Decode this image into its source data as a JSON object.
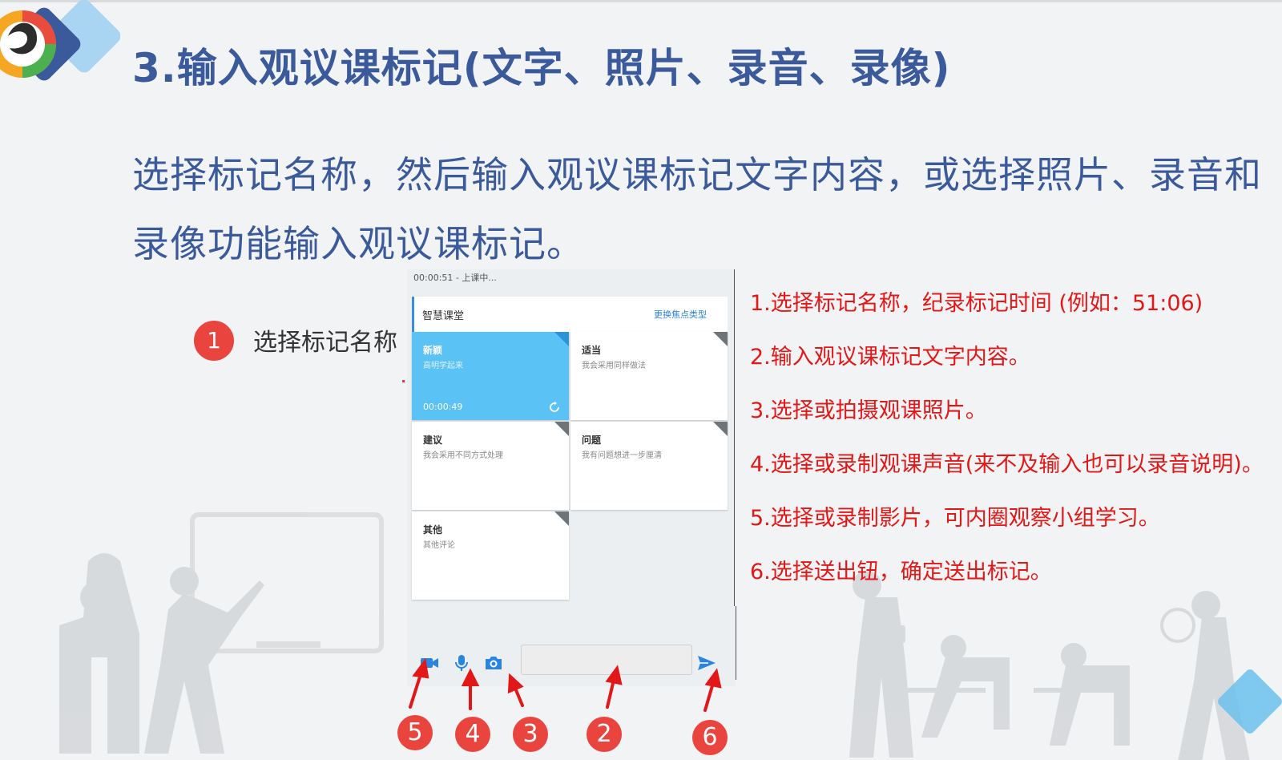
{
  "page": {
    "title": "3.输入观议课标记(文字、照片、录音、录像)",
    "intro": "选择标记名称，然后输入观议课标记文字内容，或选择照片、录音和录像功能输入观议课标记。",
    "step": {
      "number": "1",
      "label": "选择标记名称"
    }
  },
  "app": {
    "status": "00:00:51 - 上课中...",
    "header_title": "智慧课堂",
    "header_link": "更换焦点类型",
    "cards": [
      {
        "title": "新颖",
        "desc": "高明学起来",
        "time": "00:00:49"
      },
      {
        "title": "适当",
        "desc": "我会采用同样做法"
      },
      {
        "title": "建议",
        "desc": "我会采用不同方式处理"
      },
      {
        "title": "问题",
        "desc": "我有问题想进一步厘清"
      },
      {
        "title": "其他",
        "desc": "其他评论"
      }
    ],
    "toolbar": {
      "icons": [
        "video-camera-icon",
        "microphone-icon",
        "camera-icon",
        "send-icon"
      ],
      "input_placeholder": ""
    }
  },
  "markers": [
    "5",
    "4",
    "3",
    "2",
    "6"
  ],
  "instructions": [
    "1.选择标记名称，纪录标记时间 (例如：51:06)",
    "2.输入观议课标记文字内容。",
    "3.选择或拍摄观课照片。",
    "4.选择或录制观课声音(来不及输入也可以录音说明)。",
    "5.选择或录制影片，可内圈观察小组学习。",
    "6.选择送出钮，确定送出标记。"
  ],
  "colors": {
    "title": "#3a5a9c",
    "accent_red": "#e9453e",
    "active_card": "#5ac2f4",
    "icon_blue": "#2b84e0"
  }
}
